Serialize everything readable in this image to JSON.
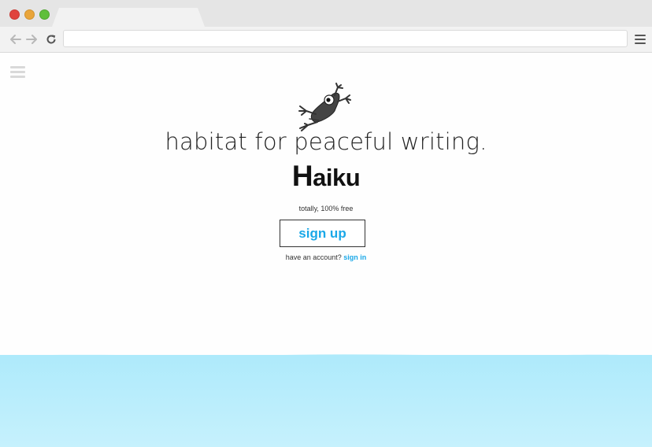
{
  "browser": {
    "address_value": "",
    "window_controls": [
      "close",
      "minimize",
      "maximize"
    ],
    "icons": [
      "back-arrow-icon",
      "forward-arrow-icon",
      "reload-icon",
      "browser-menu-icon"
    ]
  },
  "page": {
    "menu_icon": "hamburger-menu-icon",
    "logo_icon": "frog-logo-icon",
    "tagline": "habitat for peaceful writing.",
    "brand_first": "H",
    "brand_rest": "aiku",
    "free_note": "totally, 100% free",
    "signup_label": "sign up",
    "account_prompt": "have an account?",
    "signin_label": "sign in",
    "colors": {
      "link": "#1aa8e8",
      "water_top": "#aeeafb",
      "water_bottom": "#c6f1fd"
    }
  }
}
